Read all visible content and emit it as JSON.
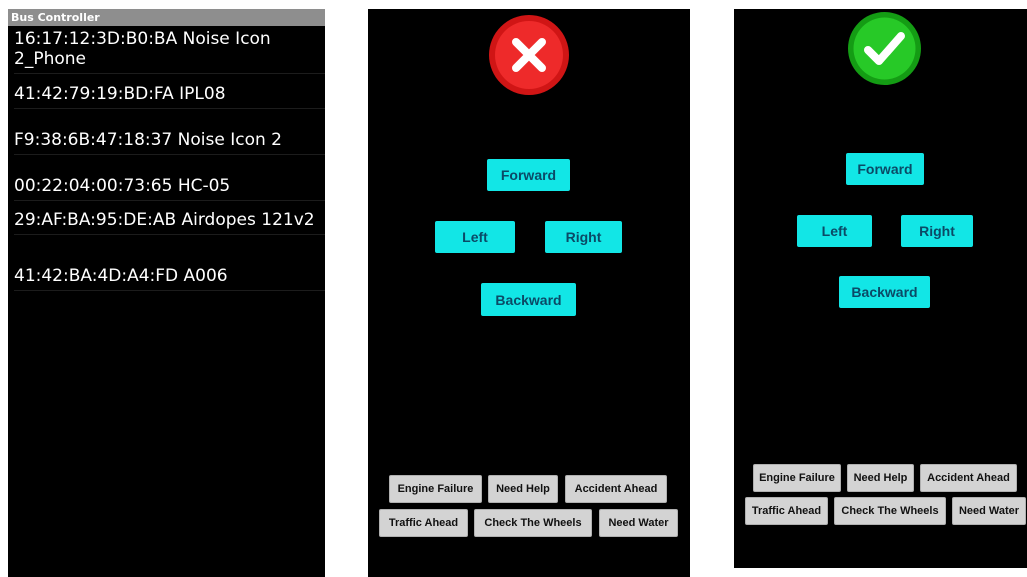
{
  "device_list": {
    "title": "Bus Controller",
    "devices": [
      {
        "label": "16:17:12:3D:B0:BA Noise Icon 2_Phone"
      },
      {
        "label": "41:42:79:19:BD:FA IPL08"
      },
      {
        "label": "F9:38:6B:47:18:37 Noise Icon 2"
      },
      {
        "label": "00:22:04:00:73:65 HC-05"
      },
      {
        "label": "29:AF:BA:95:DE:AB Airdopes 121v2"
      },
      {
        "label": "41:42:BA:4D:A4:FD A006"
      }
    ]
  },
  "disconnected": {
    "status_icon": "cross-icon",
    "status_color": "#e51e1e",
    "controls": {
      "forward": "Forward",
      "left": "Left",
      "right": "Right",
      "backward": "Backward"
    },
    "alerts_row1": [
      "Engine Failure",
      "Need Help",
      "Accident Ahead"
    ],
    "alerts_row2": [
      "Traffic Ahead",
      "Check The Wheels",
      "Need Water"
    ]
  },
  "connected": {
    "status_icon": "check-icon",
    "status_color": "#1fbf1f",
    "controls": {
      "forward": "Forward",
      "left": "Left",
      "right": "Right",
      "backward": "Backward"
    },
    "alerts_row1": [
      "Engine Failure",
      "Need Help",
      "Accident Ahead"
    ],
    "alerts_row2": [
      "Traffic Ahead",
      "Check The Wheels",
      "Need Water"
    ]
  },
  "colors": {
    "control_button": "#12e6e6",
    "alert_button": "#d3d3d3",
    "background": "#000000"
  }
}
